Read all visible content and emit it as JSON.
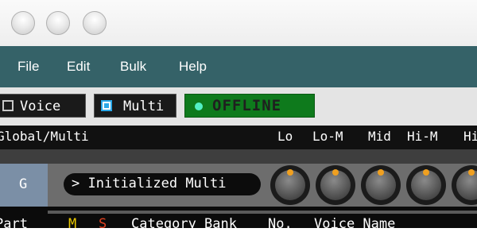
{
  "menu": {
    "file": "File",
    "edit": "Edit",
    "bulk": "Bulk",
    "help": "Help"
  },
  "modes": {
    "voice": "Voice",
    "multi": "Multi",
    "status": "OFFLINE"
  },
  "header": {
    "section": "Global/Multi",
    "eq_lo": "Lo",
    "eq_lo_m": "Lo-M",
    "eq_mid": "Mid",
    "eq_hi_m": "Hi-M",
    "eq_hi": "Hi"
  },
  "row": {
    "label": "G",
    "multi_name": "Initialized Multi",
    "arrow": ">"
  },
  "columns": {
    "part": "Part",
    "mute": "M",
    "solo": "S",
    "category": "Category",
    "bank": "Bank",
    "no": "No.",
    "voice_name": "Voice Name"
  },
  "colors": {
    "menubar": "#356268",
    "offline": "#0e7a1c",
    "accent_knob": "#f0a020",
    "mute": "#e8c700",
    "solo": "#e04020"
  }
}
